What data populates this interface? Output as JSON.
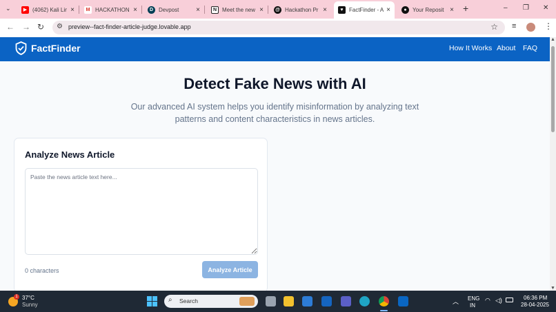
{
  "browser": {
    "tabs": [
      {
        "title": "(4062) Kali Lin",
        "icon": "youtube-icon",
        "color": "#ff0000"
      },
      {
        "title": "HACKATHON",
        "icon": "gmail-icon",
        "color": "#d93025"
      },
      {
        "title": "Devpost",
        "icon": "devpost-icon",
        "color": "#003e54"
      },
      {
        "title": "Meet the new",
        "icon": "notion-icon",
        "color": "#222222"
      },
      {
        "title": "Hackathon Pr",
        "icon": "threads-icon",
        "color": "#111111"
      },
      {
        "title": "FactFinder - A",
        "icon": "lovable-icon",
        "color": "#111111",
        "active": true
      },
      {
        "title": "Your Reposit",
        "icon": "github-icon",
        "color": "#111111"
      }
    ],
    "new_tab_glyph": "+",
    "window_controls": [
      "–",
      "❐",
      "✕"
    ],
    "url": "preview--fact-finder-article-judge.lovable.app"
  },
  "app": {
    "brand": "FactFinder",
    "nav": [
      "How It Works",
      "About",
      "FAQ"
    ],
    "hero_title": "Detect Fake News with AI",
    "hero_subtitle": "Our advanced AI system helps you identify misinformation by analyzing text patterns and content characteristics in news articles.",
    "card_title": "Analyze News Article",
    "input_placeholder": "Paste the news article text here...",
    "input_value": "",
    "char_count": "0 characters",
    "analyze_button": "Analyze Article",
    "accent_color": "#0b63c4"
  },
  "taskbar": {
    "weather_temp": "37°C",
    "weather_desc": "Sunny",
    "weather_badge": "1",
    "search_label": "Search",
    "lang_top": "ENG",
    "lang_bottom": "IN",
    "time": "06:36 PM",
    "date": "28-04-2025"
  }
}
